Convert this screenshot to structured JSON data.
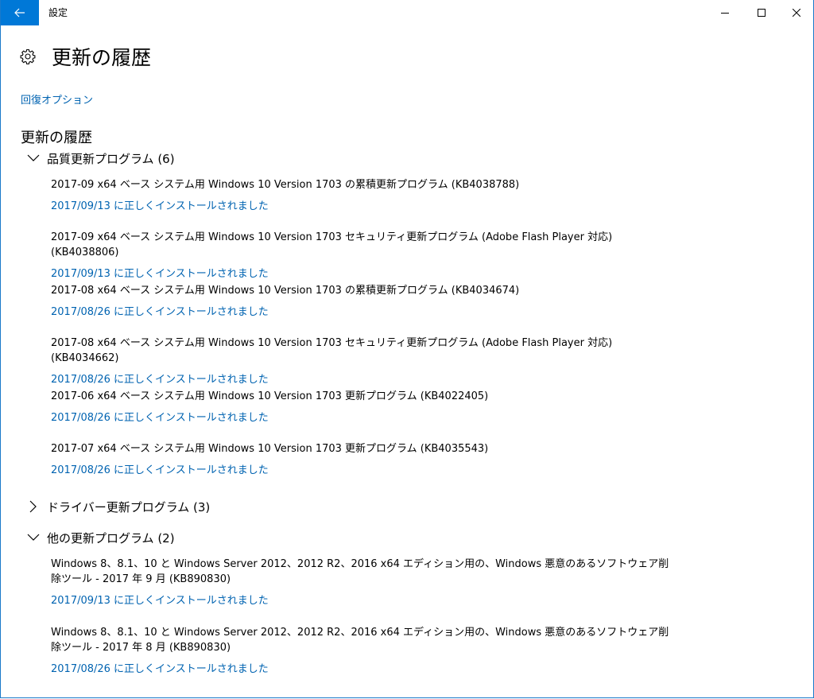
{
  "window": {
    "title": "設定"
  },
  "header": {
    "title": "更新の履歴"
  },
  "recovery_link": "回復オプション",
  "section_title": "更新の履歴",
  "groups": [
    {
      "label": "品質更新プログラム (6)",
      "expanded": true,
      "items": [
        {
          "name": "2017-09 x64 ベース システム用 Windows 10 Version 1703 の累積更新プログラム (KB4038788)",
          "status": "2017/09/13 に正しくインストールされました"
        },
        {
          "name": "2017-09 x64 ベース システム用 Windows 10 Version 1703 セキュリティ更新プログラム (Adobe Flash Player 対応) (KB4038806)",
          "status": "2017/09/13 に正しくインストールされました"
        },
        {
          "name": "2017-08 x64 ベース システム用 Windows 10 Version 1703 の累積更新プログラム (KB4034674)",
          "status": "2017/08/26 に正しくインストールされました"
        },
        {
          "name": "2017-08 x64 ベース システム用 Windows 10 Version 1703 セキュリティ更新プログラム (Adobe Flash Player 対応) (KB4034662)",
          "status": "2017/08/26 に正しくインストールされました"
        },
        {
          "name": "2017-06 x64 ベース システム用 Windows 10 Version 1703 更新プログラム (KB4022405)",
          "status": "2017/08/26 に正しくインストールされました"
        },
        {
          "name": "2017-07 x64 ベース システム用 Windows 10 Version 1703 更新プログラム (KB4035543)",
          "status": "2017/08/26 に正しくインストールされました"
        }
      ]
    },
    {
      "label": "ドライバー更新プログラム (3)",
      "expanded": false,
      "items": []
    },
    {
      "label": "他の更新プログラム (2)",
      "expanded": true,
      "items": [
        {
          "name": "Windows 8、8.1、10 と Windows Server 2012、2012 R2、2016 x64 エディション用の、Windows 悪意のあるソフトウェア削除ツール - 2017 年 9 月 (KB890830)",
          "status": "2017/09/13 に正しくインストールされました"
        },
        {
          "name": "Windows 8、8.1、10 と Windows Server 2012、2012 R2、2016 x64 エディション用の、Windows 悪意のあるソフトウェア削除ツール - 2017 年 8 月 (KB890830)",
          "status": "2017/08/26 に正しくインストールされました"
        }
      ]
    }
  ],
  "icons": {
    "back": "back-arrow-icon",
    "settings": "gear-icon",
    "minimize": "minimize-icon",
    "maximize": "maximize-icon",
    "close": "close-icon",
    "expanded": "chevron-down-icon",
    "collapsed": "chevron-right-icon"
  },
  "colors": {
    "accent": "#0078d7",
    "link": "#0063b1"
  }
}
